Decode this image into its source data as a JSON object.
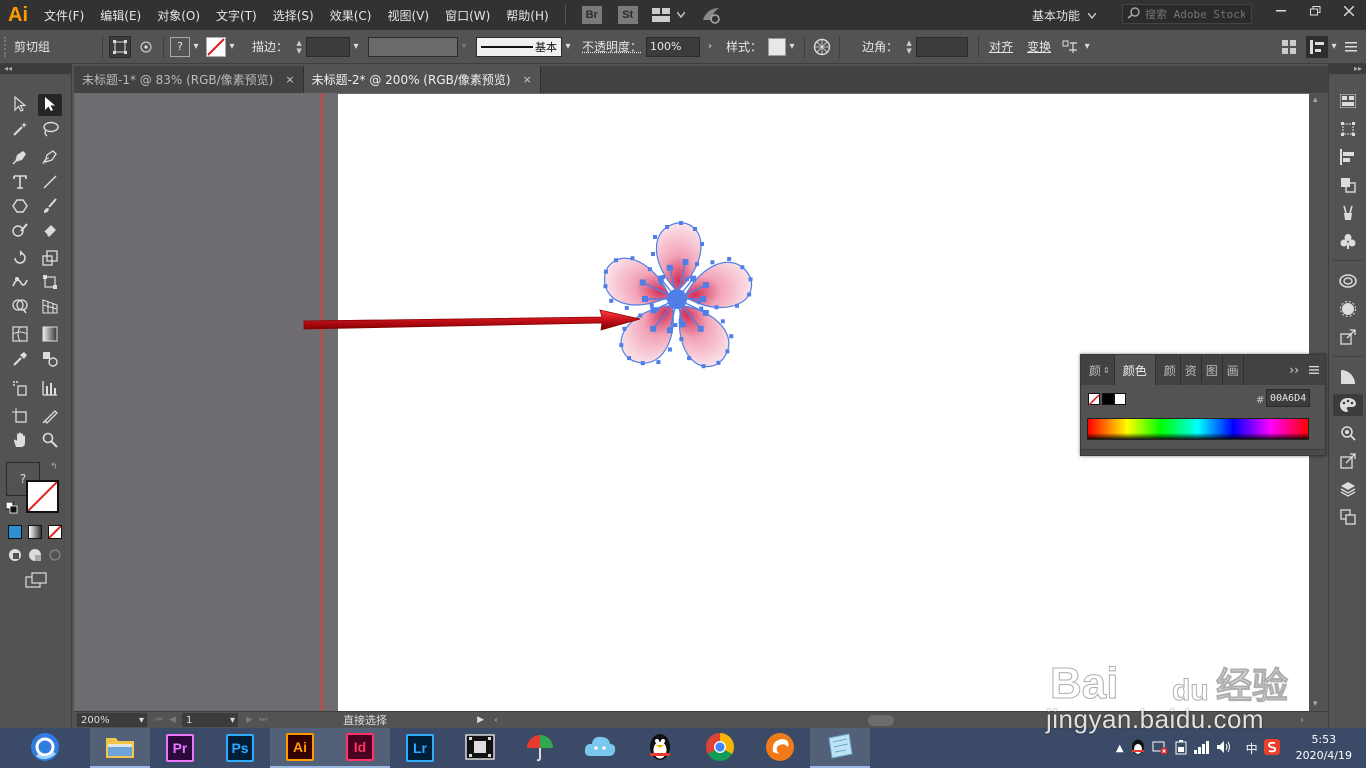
{
  "app": {
    "logo": "Ai"
  },
  "menu": [
    "文件(F)",
    "编辑(E)",
    "对象(O)",
    "文字(T)",
    "选择(S)",
    "效果(C)",
    "视图(V)",
    "窗口(W)",
    "帮助(H)"
  ],
  "bridge_label": "Br",
  "stock_label": "St",
  "workspace": "基本功能",
  "search": {
    "placeholder": "搜索 Adobe Stock"
  },
  "control_bar": {
    "group_label": "剪切组",
    "stroke_label": "描边：",
    "stroke_style": "基本",
    "opacity_label": "不透明度：",
    "opacity_value": "100%",
    "style_label": "样式：",
    "corner_label": "边角：",
    "align_label": "对齐",
    "transform_label": "变换"
  },
  "tabs": [
    {
      "label": "未标题-1* @ 83% (RGB/像素预览)",
      "close": "×"
    },
    {
      "label": "未标题-2* @ 200% (RGB/像素预览)",
      "close": "×"
    }
  ],
  "tool_extras": {
    "unknown_fill": "?"
  },
  "status_bar": {
    "zoom": "200%",
    "artboard": "1",
    "tool_name": "直接选择"
  },
  "color_panel": {
    "tabs": [
      "颜色参考",
      "颜色",
      "颜色主题",
      "资源导出",
      "图层",
      "画板"
    ],
    "tabs_visible": [
      "颜",
      "颜色",
      "颜",
      "资",
      "图",
      "画"
    ],
    "hex_label": "#",
    "hex_value": "00A6D4"
  },
  "taskbar": {
    "apps": [
      {
        "name": "browser",
        "label": ""
      },
      {
        "name": "file-explorer",
        "label": ""
      },
      {
        "name": "premiere",
        "label": "Pr",
        "color": "#ea77ff",
        "bg": "#2a0a3a"
      },
      {
        "name": "photoshop",
        "label": "Ps",
        "color": "#31a8ff",
        "bg": "#001e36"
      },
      {
        "name": "illustrator",
        "label": "Ai",
        "color": "#ff9a00",
        "bg": "#330000"
      },
      {
        "name": "indesign",
        "label": "Id",
        "color": "#ff3366",
        "bg": "#49021f"
      },
      {
        "name": "lightroom",
        "label": "Lr",
        "color": "#31a8ff",
        "bg": "#001e36"
      }
    ],
    "tray_ime": "中",
    "time": "5:53",
    "date": "2020/4/19"
  },
  "watermark": {
    "brand": "Bai",
    "brand2": "du",
    "cn": "经验",
    "url": "jingyan.baidu.com"
  },
  "colors": {
    "accent_fill": "#00A6D4",
    "selection_blue": "#4f7fe6",
    "guide_red": "#d1453b",
    "arrow_red": "#e0191a"
  }
}
